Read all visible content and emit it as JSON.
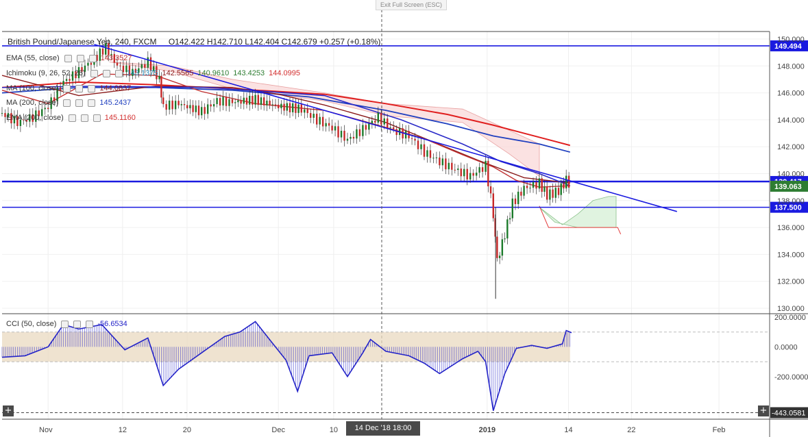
{
  "header": {
    "exit_fullscreen": "Exit Full Screen (ESC)",
    "symbol": "British Pound/Japanese Yen, 240, FXCM",
    "ohlc": "O142.422  H142.710  L142.404  C142.679  +0.257 (+0.18%)"
  },
  "legend": {
    "ema55": {
      "label": "EMA (55, close)",
      "value": "143.3527",
      "color": "#c03030"
    },
    "ichimoku": {
      "label": "Ichimoku (9, 26, 52, 26)",
      "values": [
        "143.1375",
        "142.5565",
        "140.9610",
        "143.4253",
        "144.0995"
      ],
      "colors": [
        "#2a8fbd",
        "#8b1a1a",
        "#2e7d32",
        "#2e7d32",
        "#d32f2f"
      ]
    },
    "ma100": {
      "label": "MA (100, close)",
      "value": "144.0837",
      "color": "#8b1a1a"
    },
    "ma200": {
      "label": "MA (200, close)",
      "value": "145.2437",
      "color": "#1f3fbf"
    },
    "ema200": {
      "label": "EMA (200, close)",
      "value": "145.1160",
      "color": "#d32f2f"
    },
    "cci": {
      "label": "CCI (50, close)",
      "value": "-56.6534",
      "color": "#2323c8"
    }
  },
  "chart_data": {
    "type": "candlestick",
    "price_axis": {
      "min": 130,
      "max": 150,
      "ticks": [
        "150.000",
        "148.000",
        "146.000",
        "144.000",
        "142.000",
        "140.000",
        "138.000",
        "136.000",
        "134.000",
        "132.000",
        "130.000"
      ]
    },
    "x_axis_ticks": [
      "Nov",
      "12",
      "20",
      "Dec",
      "10",
      "2019",
      "14",
      "22",
      "Feb"
    ],
    "crosshair_label": "14 Dec '18   18:00",
    "horizontal_levels": [
      {
        "price": 149.494,
        "label": "149.494"
      },
      {
        "price": 139.417,
        "label": "139.417"
      },
      {
        "price": 137.5,
        "label": "137.500"
      }
    ],
    "last_price": {
      "price": 139.063,
      "label": "139.063"
    },
    "trendline": {
      "start": {
        "x": 0.12,
        "y": 149.6
      },
      "end": {
        "x": 0.79,
        "y": 138.0
      }
    },
    "series": [
      {
        "name": "EMA (55, close)",
        "color": "#c03030"
      },
      {
        "name": "MA (100, close)",
        "color": "#8b1a1a"
      },
      {
        "name": "MA (200, close)",
        "color": "#1f3fbf"
      },
      {
        "name": "EMA (200, close)",
        "color": "#d32f2f"
      }
    ],
    "cci": {
      "range": [
        -450,
        200
      ],
      "ticks": [
        "200.0000",
        "0.0000",
        "-200.0000"
      ],
      "band": [
        -100,
        100
      ],
      "current_label": "-443.0581"
    }
  }
}
